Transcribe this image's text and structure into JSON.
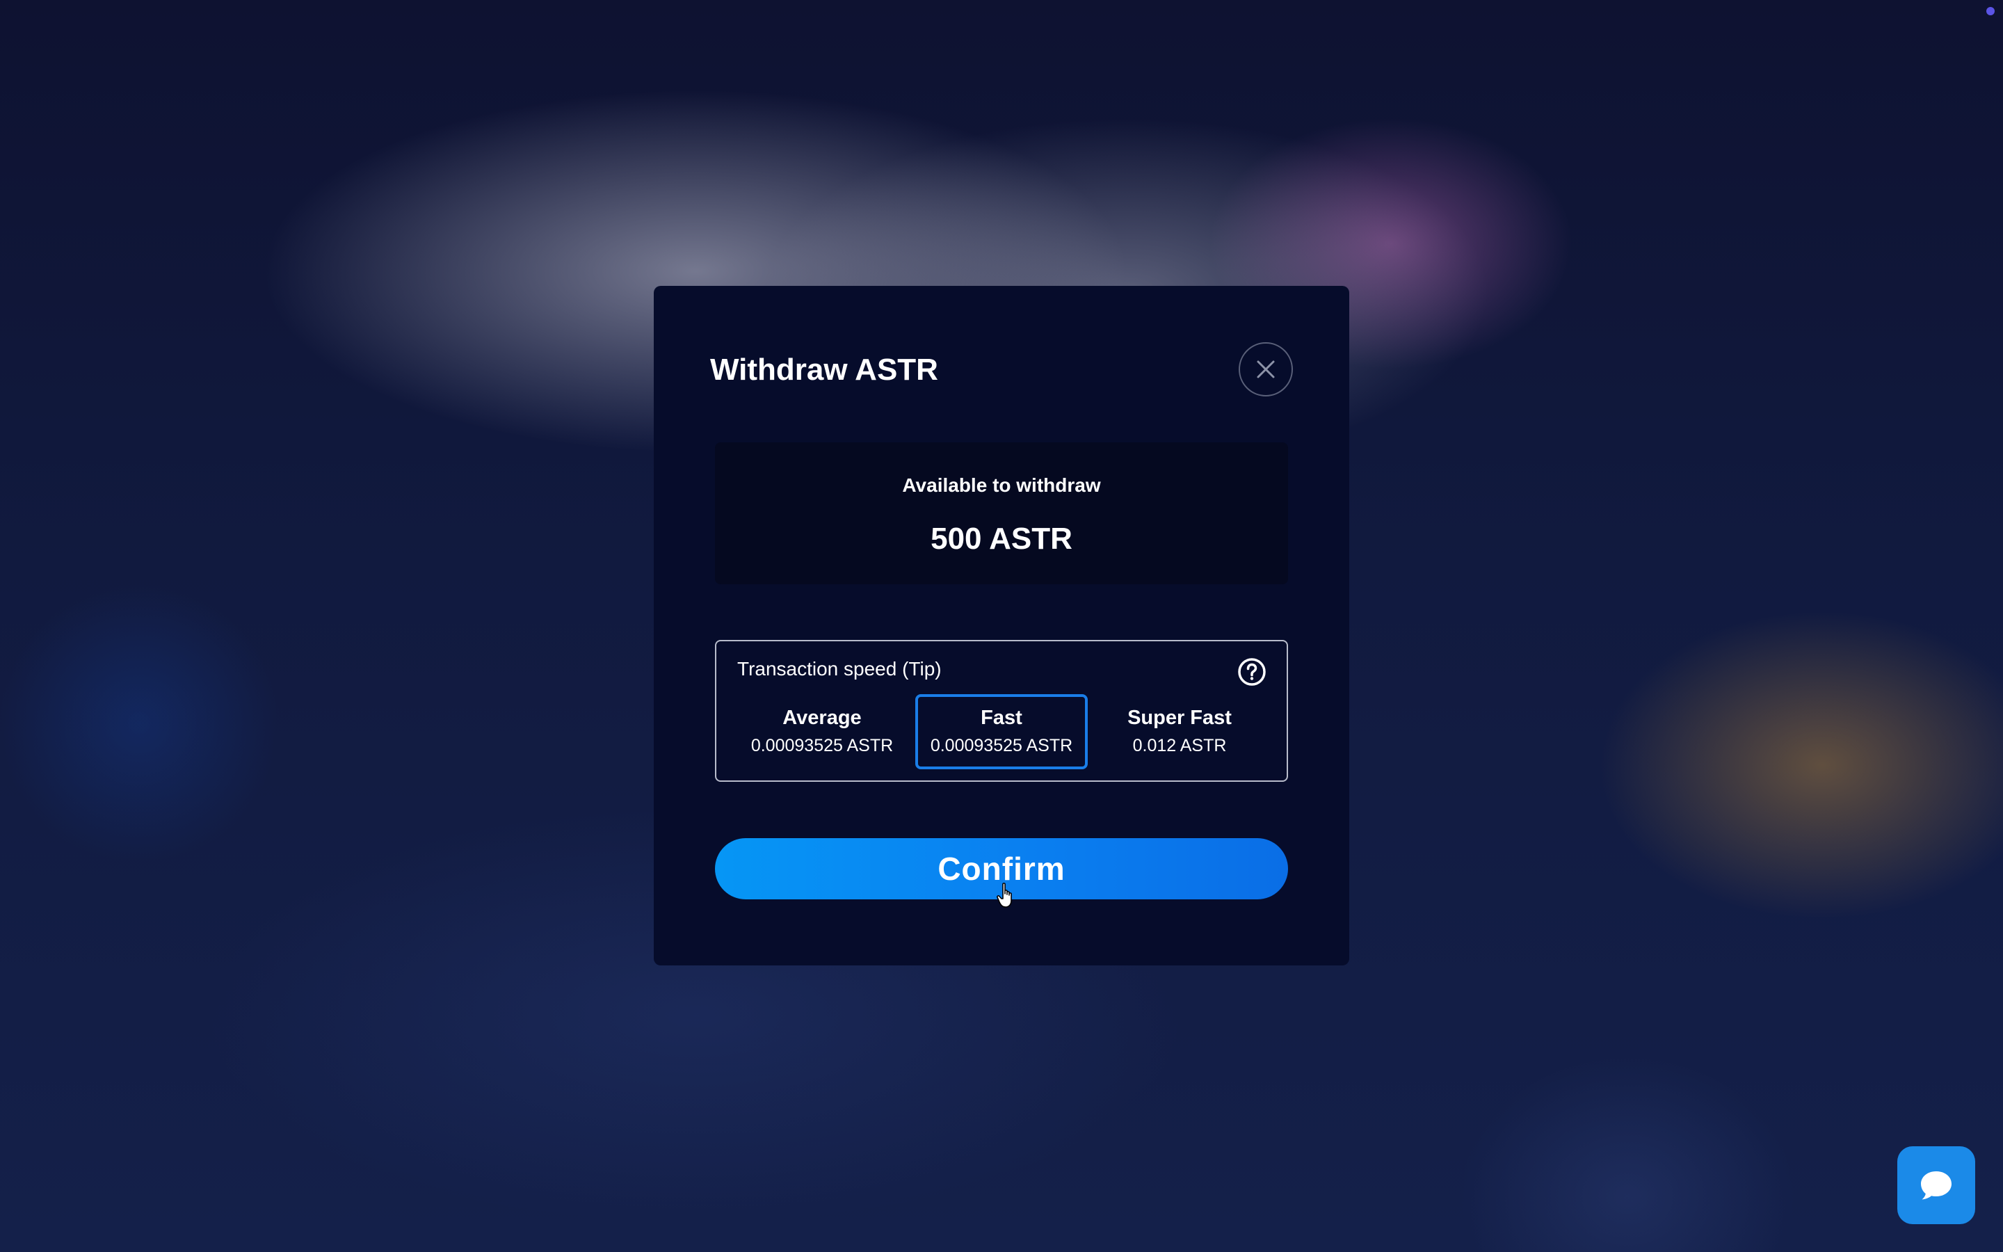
{
  "colors": {
    "modal_bg": "#060c2b",
    "accent": "#1a7ee8",
    "confirm_gradient_start": "#0696f5",
    "confirm_gradient_end": "#0a6ee6",
    "chat_button": "#1b8ae8"
  },
  "modal": {
    "title": "Withdraw ASTR",
    "close_icon": "close-icon",
    "available": {
      "label": "Available to withdraw",
      "value": "500 ASTR"
    },
    "speed": {
      "label": "Transaction speed (Tip)",
      "help_icon": "question-circle-icon",
      "options": [
        {
          "name": "Average",
          "value": "0.00093525 ASTR",
          "selected": false
        },
        {
          "name": "Fast",
          "value": "0.00093525 ASTR",
          "selected": true
        },
        {
          "name": "Super Fast",
          "value": "0.012 ASTR",
          "selected": false
        }
      ]
    },
    "confirm_label": "Confirm"
  },
  "chat": {
    "icon": "chat-bubble-icon"
  }
}
